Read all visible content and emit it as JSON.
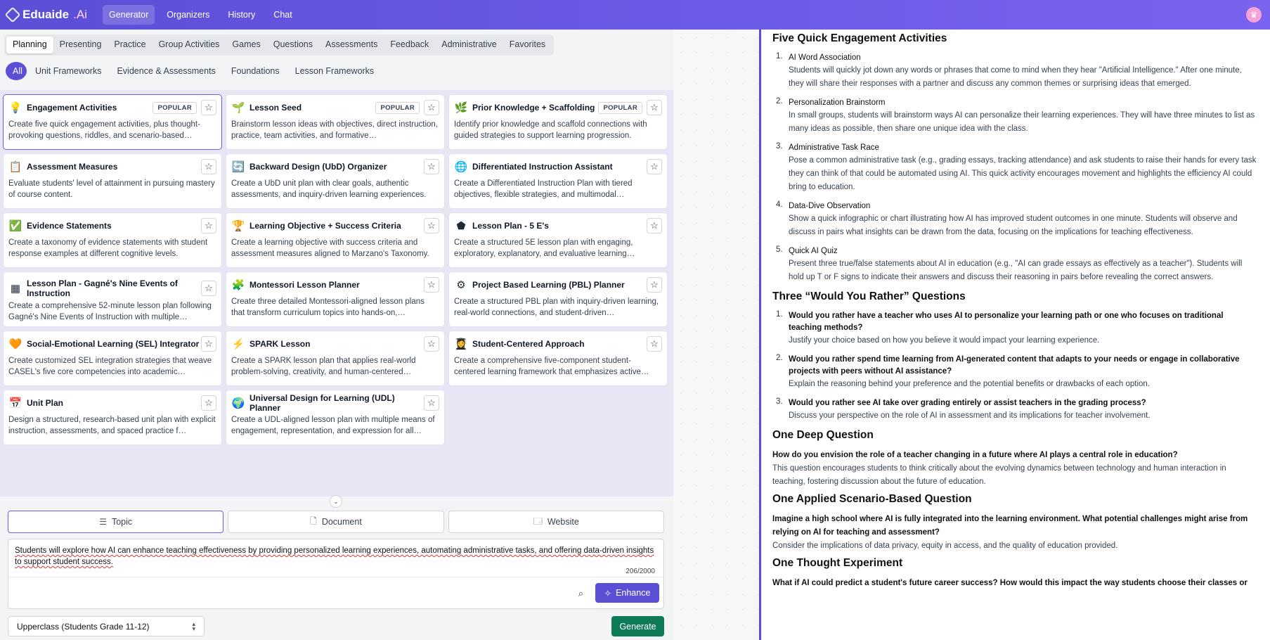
{
  "app": {
    "logo": "Eduaide",
    "logo_suffix": ".Ai",
    "nav": [
      "Generator",
      "Organizers",
      "History",
      "Chat"
    ]
  },
  "categories": [
    "Planning",
    "Presenting",
    "Practice",
    "Group Activities",
    "Games",
    "Questions",
    "Assessments",
    "Feedback",
    "Administrative",
    "Favorites"
  ],
  "subcategories": [
    "All",
    "Unit Frameworks",
    "Evidence & Assessments",
    "Foundations",
    "Lesson Frameworks"
  ],
  "cards": [
    {
      "title": "Engagement Activities",
      "badge": "POPULAR",
      "icon": "lightbulb-icon",
      "glyph": "💡",
      "desc": "Create five quick engagement activities, plus thought-provoking questions, riddles, and scenario-based…"
    },
    {
      "title": "Lesson Seed",
      "badge": "POPULAR",
      "icon": "seedling-icon",
      "glyph": "🌱",
      "desc": "Brainstorm lesson ideas with objectives, direct instruction, practice, team activities, and formative…"
    },
    {
      "title": "Prior Knowledge + Scaffolding",
      "badge": "POPULAR",
      "icon": "plant-icon",
      "glyph": "🌿",
      "desc": "Identify prior knowledge and scaffold connections with guided strategies to support learning progression."
    },
    {
      "title": "Assessment Measures",
      "badge": "",
      "icon": "clipboard-icon",
      "glyph": "📋",
      "desc": "Evaluate students' level of attainment in pursuing mastery of course content."
    },
    {
      "title": "Backward Design (UbD) Organizer",
      "badge": "",
      "icon": "backward-arrows-icon",
      "glyph": "🔄",
      "desc": "Create a UbD unit plan with clear goals, authentic assessments, and inquiry-driven learning experiences."
    },
    {
      "title": "Differentiated Instruction Assistant",
      "badge": "",
      "icon": "hierarchy-icon",
      "glyph": "🌐",
      "desc": "Create a Differentiated Instruction Plan with tiered objectives, flexible strategies, and multimodal…"
    },
    {
      "title": "Evidence Statements",
      "badge": "",
      "icon": "checkmark-bubble-icon",
      "glyph": "✅",
      "desc": "Create a taxonomy of evidence statements with student response examples at different cognitive levels."
    },
    {
      "title": "Learning Objective + Success Criteria",
      "badge": "",
      "icon": "trophy-icon",
      "glyph": "🏆",
      "desc": "Create a learning objective with success criteria and assessment measures aligned to Marzano's Taxonomy."
    },
    {
      "title": "Lesson Plan - 5 E's",
      "badge": "",
      "icon": "pentagon-icon",
      "glyph": "⬟",
      "desc": "Create a structured 5E lesson plan with engaging, exploratory, explanatory, and evaluative learning…"
    },
    {
      "title": "Lesson Plan - Gagné's Nine Events of Instruction",
      "badge": "",
      "icon": "grid-icon",
      "glyph": "▦",
      "desc": "Create a comprehensive 52-minute lesson plan following Gagné's Nine Events of Instruction with multiple…"
    },
    {
      "title": "Montessori Lesson Planner",
      "badge": "",
      "icon": "blocks-icon",
      "glyph": "🧩",
      "desc": "Create three detailed Montessori-aligned lesson plans that transform curriculum topics into hands-on,…"
    },
    {
      "title": "Project Based Learning (PBL) Planner",
      "badge": "",
      "icon": "gear-icon",
      "glyph": "⚙",
      "desc": "Create a structured PBL plan with inquiry-driven learning, real-world connections, and student-driven…"
    },
    {
      "title": "Social-Emotional Learning (SEL) Integrator",
      "badge": "",
      "icon": "heart-sun-icon",
      "glyph": "🧡",
      "desc": "Create customized SEL integration strategies that weave CASEL's five core competencies into academic…"
    },
    {
      "title": "SPARK Lesson",
      "badge": "",
      "icon": "lightning-icon",
      "glyph": "⚡",
      "desc": "Create a SPARK lesson plan that applies real-world problem-solving, creativity, and human-centered…"
    },
    {
      "title": "Student-Centered Approach",
      "badge": "",
      "icon": "student-icon",
      "glyph": "👩‍🎓",
      "desc": "Create a comprehensive five-component student-centered learning framework that emphasizes active…"
    },
    {
      "title": "Unit Plan",
      "badge": "",
      "icon": "calendar-icon",
      "glyph": "📅",
      "desc": "Design a structured, research-based unit plan with explicit instruction, assessments, and spaced practice f…"
    },
    {
      "title": "Universal Design for Learning (UDL) Planner",
      "badge": "",
      "icon": "globe-icon",
      "glyph": "🌍",
      "desc": "Create a UDL-aligned lesson plan with multiple means of engagement, representation, and expression for all…"
    }
  ],
  "source_tabs": [
    {
      "label": "Topic",
      "icon": "lines-icon",
      "glyph": "☰"
    },
    {
      "label": "Document",
      "icon": "document-icon",
      "glyph": "🗋"
    },
    {
      "label": "Website",
      "icon": "browser-icon",
      "glyph": "🗔"
    }
  ],
  "prompt": {
    "text": "Students will explore how AI can enhance teaching effectiveness by providing personalized learning experiences, automating administrative tasks, and offering data-driven insights to support student success.",
    "counter": "206/2000",
    "enhance_label": "Enhance"
  },
  "grade": {
    "value": "Upperclass (Students Grade 11-12)"
  },
  "generate_label": "Generate",
  "output": {
    "h_activities": "Five Quick Engagement Activities",
    "activities": [
      {
        "n": "1.",
        "title": "AI Word Association",
        "body": "Students will quickly jot down any words or phrases that come to mind when they hear \"Artificial Intelligence.\" After one minute, they will share their responses with a partner and discuss any common themes or surprising ideas that emerged."
      },
      {
        "n": "2.",
        "title": "Personalization Brainstorm",
        "body": "In small groups, students will brainstorm ways AI can personalize their learning experiences. They will have three minutes to list as many ideas as possible, then share one unique idea with the class."
      },
      {
        "n": "3.",
        "title": "Administrative Task Race",
        "body": "Pose a common administrative task (e.g., grading essays, tracking attendance) and ask students to raise their hands for every task they can think of that could be automated using AI. This quick activity encourages movement and highlights the efficiency AI could bring to education."
      },
      {
        "n": "4.",
        "title": "Data-Dive Observation",
        "body": "Show a quick infographic or chart illustrating how AI has improved student outcomes in one minute. Students will observe and discuss in pairs what insights can be drawn from the data, focusing on the implications for teaching effectiveness."
      },
      {
        "n": "5.",
        "title": "Quick AI Quiz",
        "body": "Present three true/false statements about AI in education (e.g., \"AI can grade essays as effectively as a teacher\"). Students will hold up T or F signs to indicate their answers and discuss their reasoning in pairs before revealing the correct answers."
      }
    ],
    "h_wyr": "Three “Would You Rather” Questions",
    "wyr": [
      {
        "n": "1.",
        "title": "Would you rather have a teacher who uses AI to personalize your learning path or one who focuses on traditional teaching methods?",
        "body": "Justify your choice based on how you believe it would impact your learning experience."
      },
      {
        "n": "2.",
        "title": "Would you rather spend time learning from AI-generated content that adapts to your needs or engage in collaborative projects with peers without AI assistance?",
        "body": "Explain the reasoning behind your preference and the potential benefits or drawbacks of each option."
      },
      {
        "n": "3.",
        "title": "Would you rather see AI take over grading entirely or assist teachers in the grading process?",
        "body": "Discuss your perspective on the role of AI in assessment and its implications for teacher involvement."
      }
    ],
    "h_deep": "One Deep Question",
    "deep_q": "How do you envision the role of a teacher changing in a future where AI plays a central role in education?",
    "deep_b": "This question encourages students to think critically about the evolving dynamics between technology and human interaction in teaching, fostering discussion about the future of education.",
    "h_applied": "One Applied Scenario-Based Question",
    "applied_q": "Imagine a high school where AI is fully integrated into the learning environment. What potential challenges might arise from relying on AI for teaching and assessment?",
    "applied_b": "Consider the implications of data privacy, equity in access, and the quality of education provided.",
    "h_thought": "One Thought Experiment",
    "thought_q": "What if AI could predict a student's future career success? How would this impact the way students choose their classes or"
  }
}
